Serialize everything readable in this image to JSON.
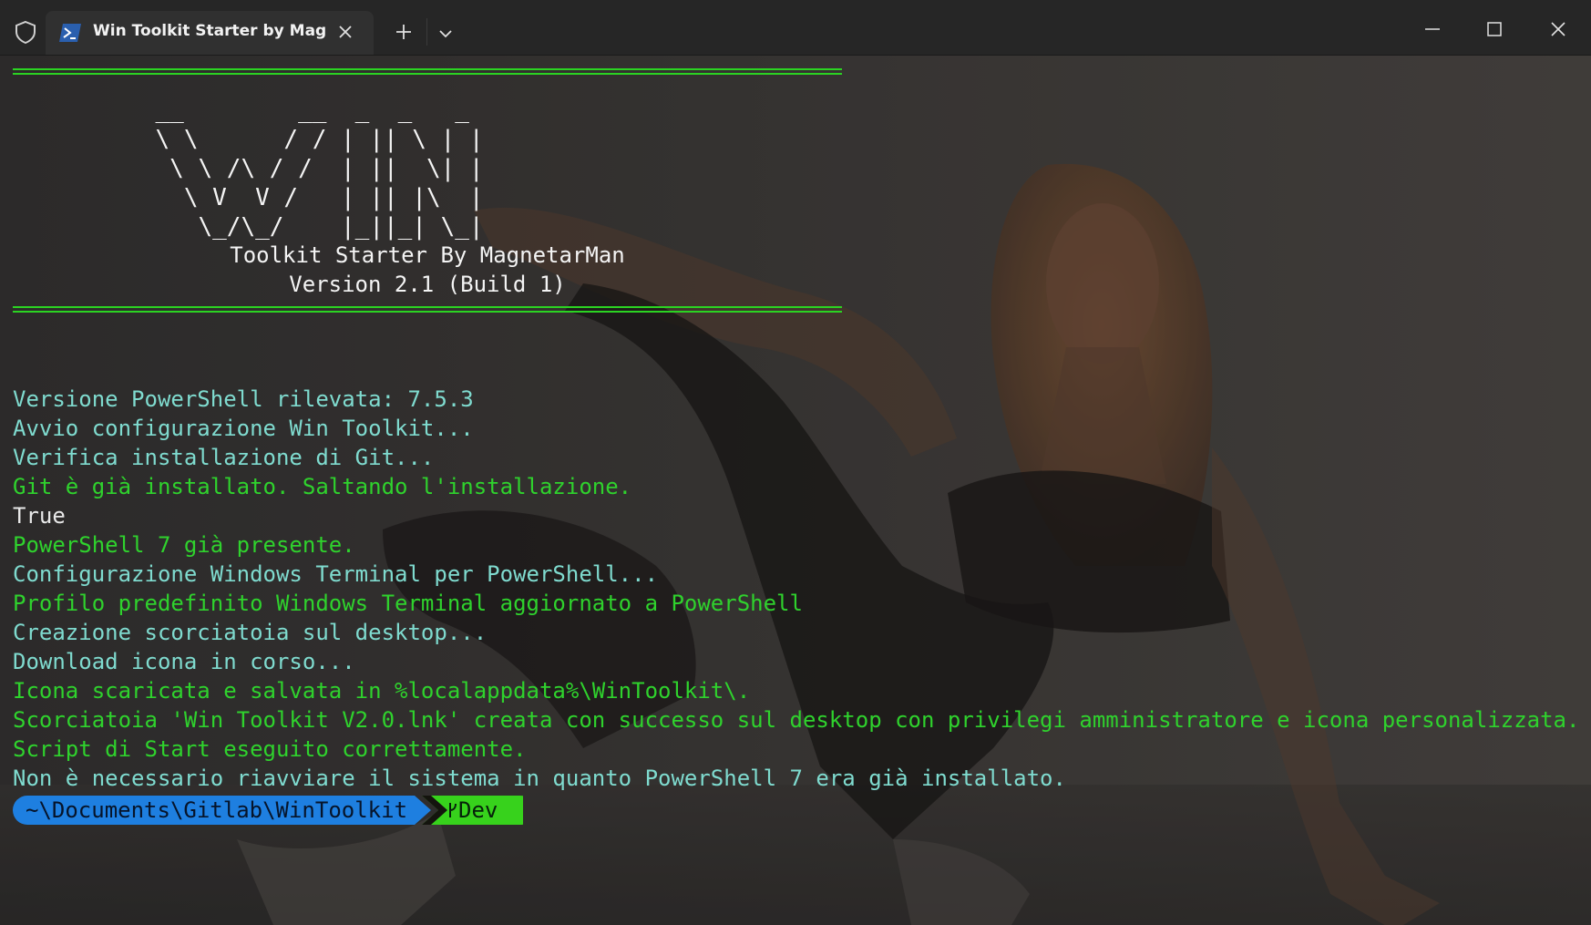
{
  "titlebar": {
    "tab_title": "Win Toolkit Starter by MagnetarMan",
    "icons": {
      "shield": "shield-icon",
      "tab": "powershell-icon",
      "close_tab": "close-icon",
      "new_tab": "plus-icon",
      "dropdown": "chevron-down-icon",
      "minimize": "minimize-icon",
      "maximize": "maximize-icon",
      "close_window": "close-icon"
    }
  },
  "banner": {
    "ascii_lines": [
      "          __        __  _  _   _",
      "          \\ \\      / / | || \\ | |",
      "           \\ \\ /\\ / /  | ||  \\| |",
      "            \\ V  V /   | || |\\  |",
      "             \\_/\\_/    |_||_| \\_|"
    ],
    "subtitle": "Toolkit Starter By MagnetarMan",
    "version": "Version 2.1 (Build 1)"
  },
  "log": [
    {
      "text": "Versione PowerShell rilevata: 7.5.3",
      "color": "cyan"
    },
    {
      "text": "Avvio configurazione Win Toolkit...",
      "color": "cyan"
    },
    {
      "text": "Verifica installazione di Git...",
      "color": "cyan"
    },
    {
      "text": "Git è già installato. Saltando l'installazione.",
      "color": "green"
    },
    {
      "text": "True",
      "color": "white"
    },
    {
      "text": "PowerShell 7 già presente.",
      "color": "green"
    },
    {
      "text": "Configurazione Windows Terminal per PowerShell...",
      "color": "cyan"
    },
    {
      "text": "Profilo predefinito Windows Terminal aggiornato a PowerShell",
      "color": "green"
    },
    {
      "text": "Creazione scorciatoia sul desktop...",
      "color": "cyan"
    },
    {
      "text": "Download icona in corso...",
      "color": "cyan"
    },
    {
      "text": "Icona scaricata e salvata in %localappdata%\\WinToolkit\\.",
      "color": "green"
    },
    {
      "text": "Scorciatoia 'Win Toolkit V2.0.lnk' creata con successo sul desktop con privilegi amministratore e icona personalizzata.",
      "color": "green"
    },
    {
      "text": "Script di Start eseguito correttamente.",
      "color": "green"
    },
    {
      "text": "Non è necessario riavviare il sistema in quanto PowerShell 7 era già installato.",
      "color": "cyan"
    }
  ],
  "prompt": {
    "path": "~\\Documents\\Gitlab\\WinToolkit",
    "branch": "Dev",
    "branch_icon": "git-branch-icon"
  },
  "colors": {
    "cyan": "#7fdbcf",
    "green": "#2fd22d",
    "white": "#e8e8e8",
    "rule": "#2bd322",
    "prompt_path_bg": "#1e7fe0",
    "prompt_branch_bg": "#37d21c",
    "titlebar_bg": "#262626"
  }
}
